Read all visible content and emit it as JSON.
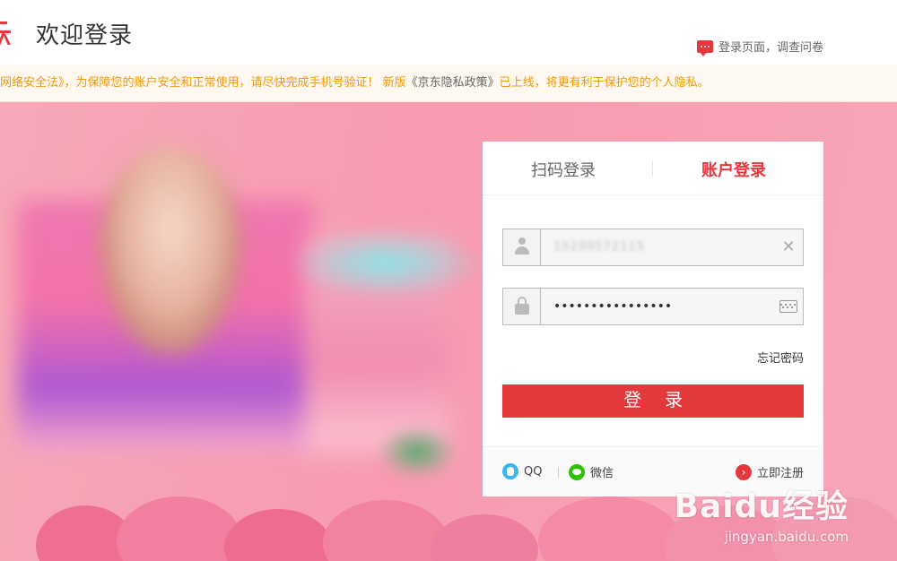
{
  "header": {
    "title": "欢迎登录",
    "survey_link": "登录页面，调查问卷"
  },
  "notice": {
    "text_before": "网络安全法》，为保障您的账户安全和正常使用，请尽快完成手机号验证！ 新版",
    "policy_link": "《京东隐私政策》",
    "text_after": "已上线，将更有利于保护您的个人隐私。"
  },
  "login": {
    "tabs": [
      {
        "label": "扫码登录",
        "active": false
      },
      {
        "label": "账户登录",
        "active": true
      }
    ],
    "username_value": "15200572115",
    "password_value": "••••••••••••••••",
    "forgot_label": "忘记密码",
    "submit_label": "登录",
    "footer": {
      "qq_label": "QQ",
      "wechat_label": "微信",
      "register_label": "立即注册"
    }
  },
  "watermark": {
    "brand": "Baidu经验",
    "url": "jingyan.baidu.com"
  },
  "colors": {
    "accent": "#e4393c",
    "notice_text": "#f39800",
    "banner_bg": "#f7a8b8"
  }
}
